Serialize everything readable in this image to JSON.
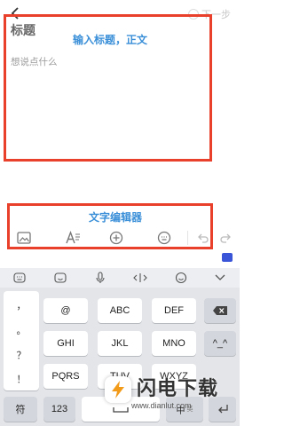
{
  "header": {
    "next_label": "下一步"
  },
  "editor": {
    "title_placeholder": "标题",
    "body_placeholder": "想说点什么"
  },
  "annotations": {
    "editor_note": "输入标题，正文",
    "toolbar_note": "文字编辑器"
  },
  "toolbar": {
    "icons": [
      "image-icon",
      "text-format-icon",
      "add-circle-icon",
      "keyboard-icon",
      "undo-icon",
      "redo-icon"
    ]
  },
  "keyboard": {
    "top_icons": [
      "keyboard-switch-icon",
      "emoji-face-icon",
      "microphone-icon",
      "cursor-move-icon",
      "smiley-icon",
      "collapse-chevron-icon"
    ],
    "symbols": [
      "，",
      "。",
      "？",
      "！"
    ],
    "keys": {
      "k1": "@",
      "k2": "ABC",
      "k3": "DEF",
      "k4": "GHI",
      "k5": "JKL",
      "k6": "MNO",
      "k7": "^_^",
      "k8": "PQRS",
      "k9": "TUV",
      "k10": "WXYZ",
      "fu": "符",
      "num": "123",
      "lang_zh": "中",
      "lang_en": "英"
    }
  },
  "watermark": {
    "title": "闪电下载",
    "url": "www.dianlut.com"
  },
  "colors": {
    "highlight_border": "#e8402a",
    "note_text": "#3a8fd8"
  }
}
